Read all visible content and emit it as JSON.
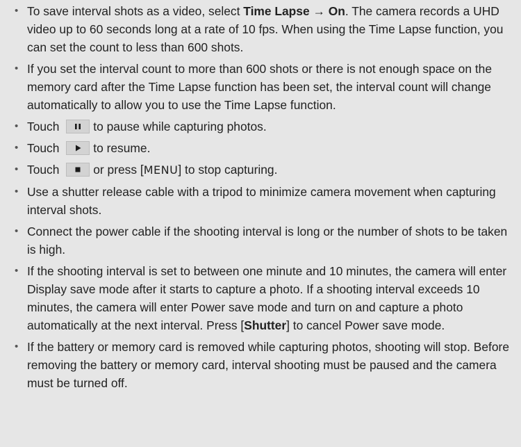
{
  "bullets": {
    "timelapse": {
      "a": "To save interval shots as a video, select ",
      "b1": "Time Lapse",
      "arrow": " → ",
      "b2": "On",
      "c": ". The camera records a UHD video up to 60 seconds long at a rate of 10 fps. When using the Time Lapse function, you can set the count to less than 600 shots."
    },
    "count": "If you set the interval count to more than 600 shots or there is not enough space on the memory card after the Time Lapse function has been set, the interval count will change automatically to allow you to use the Time Lapse function.",
    "pause": {
      "a": "Touch",
      "b": "to pause while capturing photos.",
      "icon": "pause-icon"
    },
    "resume": {
      "a": "Touch",
      "b": "to resume.",
      "icon": "play-icon"
    },
    "stop": {
      "a": "Touch",
      "b": "or press [",
      "key": "MENU",
      "c": "] to stop capturing.",
      "icon": "stop-icon"
    },
    "cable": "Use a shutter release cable with a tripod to minimize camera movement when capturing interval shots.",
    "power": "Connect the power cable if the shooting interval is long or the number of shots to be taken is high.",
    "saveMode": {
      "a": "If the shooting interval is set to between one minute and 10 minutes, the camera will enter Display save mode after it starts to capture a photo. If a shooting interval exceeds 10 minutes, the camera will enter Power save mode and turn on and capture a photo automatically at the next interval. Press [",
      "b": "Shutter",
      "c": "] to cancel Power save mode."
    },
    "battery": "If the battery or memory card is removed while capturing photos, shooting will stop. Before removing the battery or memory card, interval shooting must be paused and the camera must be turned off."
  },
  "colors": {
    "background": "#e6e6e6",
    "text": "#222222",
    "button": "#d3d3d3",
    "glyph": "#1a1a1a"
  }
}
